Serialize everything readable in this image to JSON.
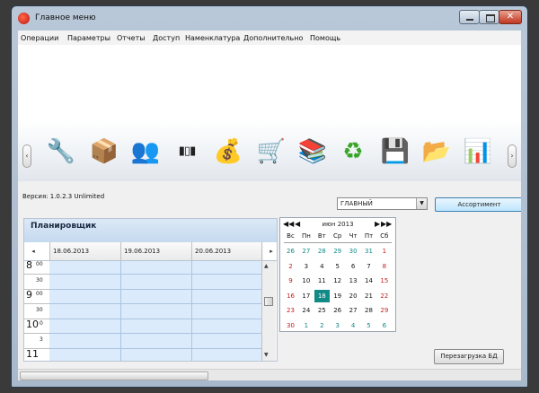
{
  "window": {
    "title": "Главное меню",
    "close_glyph": "✕"
  },
  "menu": [
    "Операции",
    "Параметры",
    "Отчеты",
    "Доступ",
    "Наменклатура",
    "Дополнительно",
    "Помощь"
  ],
  "toolbar": {
    "left_arrow": "‹",
    "right_arrow": "›",
    "icons": [
      {
        "name": "tools-icon",
        "glyph": "🔧"
      },
      {
        "name": "box-arrow-icon",
        "glyph": "📦"
      },
      {
        "name": "users-icon",
        "glyph": "👥"
      },
      {
        "name": "barcode-icon",
        "glyph": "▮▯▮"
      },
      {
        "name": "money-bag-icon",
        "glyph": "💰"
      },
      {
        "name": "shopping-cart-icon",
        "glyph": "🛒"
      },
      {
        "name": "books-icon",
        "glyph": "📚"
      },
      {
        "name": "refresh-arrows-icon",
        "glyph": "♻"
      },
      {
        "name": "floppy-disk-icon",
        "glyph": "💾"
      },
      {
        "name": "folders-icon",
        "glyph": "📂"
      },
      {
        "name": "chart-icon",
        "glyph": "📊"
      }
    ]
  },
  "version": "Версия: 1.0.2.3 Unlimited",
  "combo": {
    "value": "ГЛАВНЫЙ",
    "arrow": "▼"
  },
  "assortment_button": "Ассортимент",
  "reload_button": "Перезагрузка БД",
  "planner": {
    "title": "Планировщик",
    "nav_left": "◂",
    "nav_right": "▸",
    "dates": [
      "18.06.2013",
      "19.06.2013",
      "20.06.2013"
    ],
    "hours": [
      {
        "hour": "8",
        "sup": "00",
        "half": "30"
      },
      {
        "hour": "9",
        "sup": "00",
        "half": "30"
      },
      {
        "hour": "10",
        "sup": "0",
        "half": "3"
      },
      {
        "hour": "11",
        "sup": "",
        "half": ""
      }
    ],
    "scroll_up": "▲",
    "scroll_down": "▼"
  },
  "calendar": {
    "prev_year": "◀◀",
    "prev_month": "◀",
    "month": "июн 2013",
    "next_month": "▶",
    "next_year": "▶▶",
    "weekdays": [
      "Вс",
      "Пн",
      "Вт",
      "Ср",
      "Чт",
      "Пт",
      "Сб"
    ],
    "weeks": [
      [
        "26",
        "27",
        "28",
        "29",
        "30",
        "31",
        "1"
      ],
      [
        "2",
        "3",
        "4",
        "5",
        "6",
        "7",
        "8"
      ],
      [
        "9",
        "10",
        "11",
        "12",
        "13",
        "14",
        "15"
      ],
      [
        "16",
        "17",
        "18",
        "19",
        "20",
        "21",
        "22"
      ],
      [
        "23",
        "24",
        "25",
        "26",
        "27",
        "28",
        "29"
      ],
      [
        "30",
        "1",
        "2",
        "3",
        "4",
        "5",
        "6"
      ]
    ],
    "today": "18"
  }
}
